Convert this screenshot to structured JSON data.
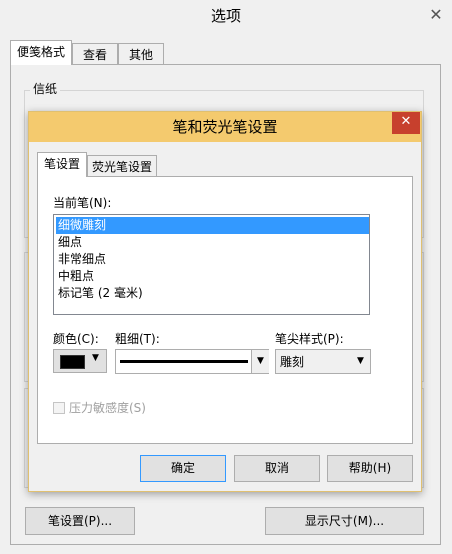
{
  "window": {
    "title": "选项",
    "close_glyph": "✕"
  },
  "outer_tabs": [
    {
      "label": "便笺格式",
      "active": true
    },
    {
      "label": "查看",
      "active": false
    },
    {
      "label": "其他",
      "active": false
    }
  ],
  "paper_group": {
    "label": "信纸"
  },
  "outer_buttons": {
    "pen_settings": "笔设置(P)...",
    "display_size": "显示尺寸(M)..."
  },
  "dialog": {
    "title": "笔和荧光笔设置",
    "close_glyph": "✕",
    "tabs": [
      {
        "label": "笔设置",
        "active": true
      },
      {
        "label": "荧光笔设置",
        "active": false
      }
    ],
    "current_pen_label": "当前笔(N):",
    "pen_list": [
      {
        "label": "细微雕刻",
        "selected": true
      },
      {
        "label": "细点",
        "selected": false
      },
      {
        "label": "非常细点",
        "selected": false
      },
      {
        "label": "中粗点",
        "selected": false
      },
      {
        "label": "标记笔 (2 毫米)",
        "selected": false
      }
    ],
    "color_label": "颜色(C):",
    "color_value": "#000000",
    "thickness_label": "粗细(T):",
    "tip_style_label": "笔尖样式(P):",
    "tip_style_value": "雕刻",
    "pressure_label": "压力敏感度(S)",
    "pressure_checked": false,
    "pressure_enabled": false,
    "buttons": {
      "ok": "确定",
      "cancel": "取消",
      "help": "帮助(H)"
    }
  },
  "colors": {
    "dialog_title_bg": "#f4ca6e",
    "close_button_bg": "#c7402d",
    "selection_bg": "#3399ff"
  }
}
